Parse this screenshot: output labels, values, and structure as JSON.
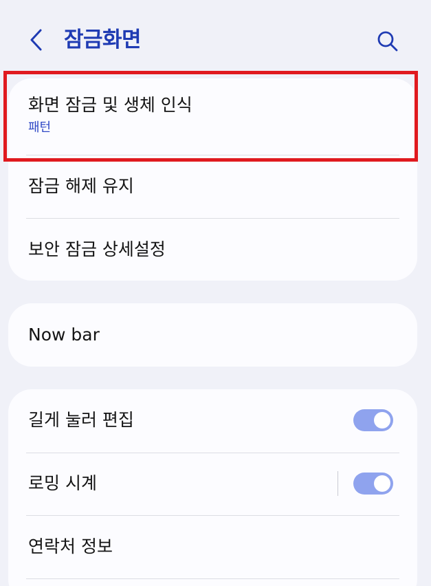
{
  "header": {
    "title": "잠금화면",
    "back_icon": "chevron-left-icon",
    "search_icon": "search-icon"
  },
  "section1": {
    "items": [
      {
        "title": "화면 잠금 및 생체 인식",
        "subtitle": "패턴"
      },
      {
        "title": "잠금 해제 유지"
      },
      {
        "title": "보안 잠금 상세설정"
      }
    ]
  },
  "section2": {
    "items": [
      {
        "title": "Now bar"
      }
    ]
  },
  "section3": {
    "items": [
      {
        "title": "길게 눌러 편집",
        "toggle_on": true
      },
      {
        "title": "로밍 시계",
        "toggle_on": true
      },
      {
        "title": "연락처 정보"
      }
    ]
  },
  "colors": {
    "accent": "#1f3bb3",
    "subtitle": "#2f48c6",
    "toggle_on": "#8fa3ee",
    "background": "#f0f1f8",
    "card": "#fcfcff",
    "highlight": "#e01a1f"
  }
}
